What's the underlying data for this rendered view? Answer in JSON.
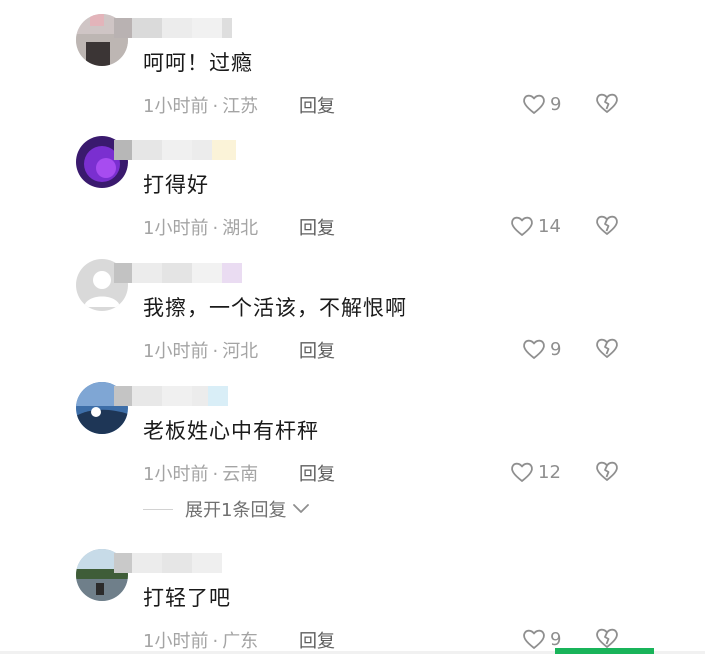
{
  "comments": [
    {
      "text": "呵呵！过瘾",
      "time": "1小时前",
      "location": "江苏",
      "reply_label": "回复",
      "likes": "9"
    },
    {
      "text": "打得好",
      "time": "1小时前",
      "location": "湖北",
      "reply_label": "回复",
      "likes": "14"
    },
    {
      "text": "我擦，一个活该，不解恨啊",
      "time": "1小时前",
      "location": "河北",
      "reply_label": "回复",
      "likes": "9"
    },
    {
      "text": "老板姓心中有杆秤",
      "time": "1小时前",
      "location": "云南",
      "reply_label": "回复",
      "likes": "12"
    },
    {
      "text": "打轻了吧",
      "time": "1小时前",
      "location": "广东",
      "reply_label": "回复",
      "likes": "9"
    }
  ],
  "expand_replies_label": "展开1条回复",
  "icons": {
    "like": "heart-outline-icon",
    "dislike": "broken-heart-icon",
    "expand": "chevron-down-icon"
  },
  "colors": {
    "text": "#1a1a1a",
    "meta": "#a4a4a4",
    "reply": "#5e5e5e",
    "accent": "#19b45a"
  }
}
